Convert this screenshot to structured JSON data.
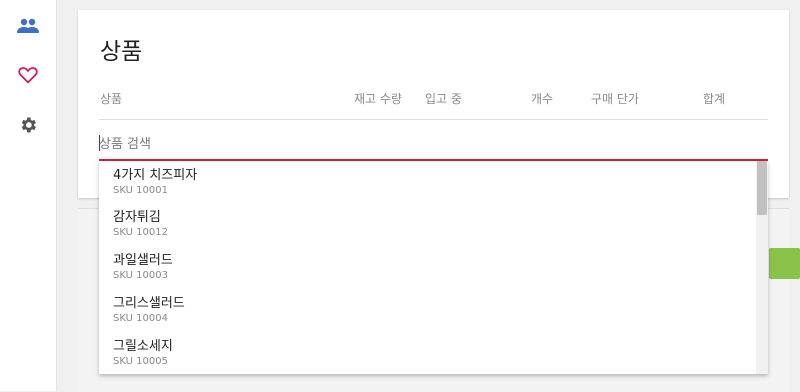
{
  "sidebar": {
    "items": [
      {
        "icon": "people-icon",
        "color": "#3f6fc4"
      },
      {
        "icon": "heart-icon",
        "color": "#d81b60"
      },
      {
        "icon": "gear-icon",
        "color": "#555555"
      }
    ]
  },
  "card": {
    "title": "상품",
    "columns": [
      "상품",
      "재고 수량",
      "입고 중",
      "개수",
      "구매 단가",
      "합계"
    ]
  },
  "search": {
    "placeholder": "상품 검색",
    "value": ""
  },
  "dropdown": {
    "items": [
      {
        "name": "4가지 치즈피자",
        "sku": "SKU 10001"
      },
      {
        "name": "감자튀김",
        "sku": "SKU 10012"
      },
      {
        "name": "과일샐러드",
        "sku": "SKU 10003"
      },
      {
        "name": "그리스샐러드",
        "sku": "SKU 10004"
      },
      {
        "name": "그릴소세지",
        "sku": "SKU 10005"
      }
    ]
  },
  "colors": {
    "accent": "#d81b3c",
    "action_button": "#8bc34a"
  }
}
